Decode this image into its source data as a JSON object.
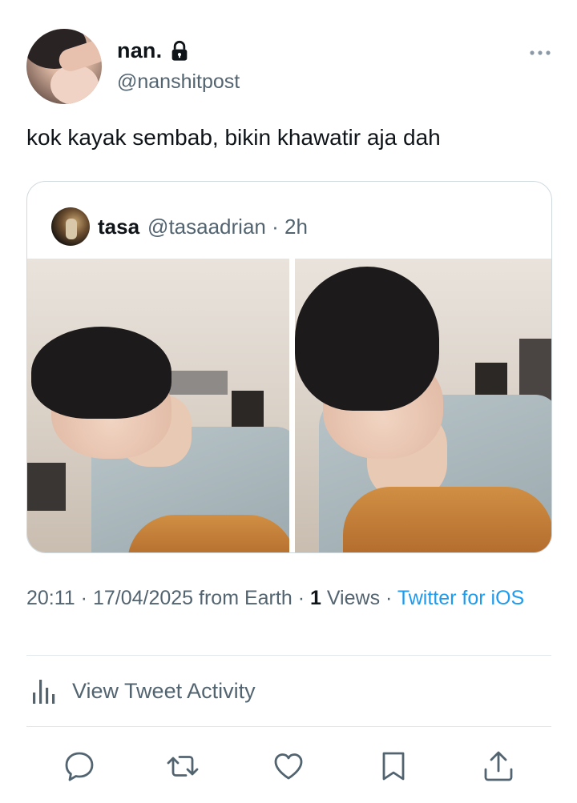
{
  "author": {
    "display_name": "nan.",
    "handle": "@nanshitpost"
  },
  "tweet": {
    "text": "kok kayak sembab, bikin khawatir aja dah"
  },
  "quote": {
    "display_name": "tasa",
    "handle": "@tasaadrian",
    "separator": "·",
    "time": "2h"
  },
  "meta": {
    "time": "20:11",
    "sep1": "·",
    "date": "17/04/2025",
    "location": "from Earth",
    "sep2": "·",
    "views_count": "1",
    "views_label": "Views",
    "sep3": "·",
    "client": "Twitter for iOS"
  },
  "activity": {
    "label": "View Tweet Activity"
  },
  "colors": {
    "text": "#0f1419",
    "secondary": "#536471",
    "link": "#1d9bf0",
    "border": "#cfd9de"
  },
  "icons": [
    "lock-icon",
    "more-icon",
    "bar-chart-icon",
    "reply-icon",
    "retweet-icon",
    "like-icon",
    "bookmark-icon",
    "share-icon"
  ]
}
